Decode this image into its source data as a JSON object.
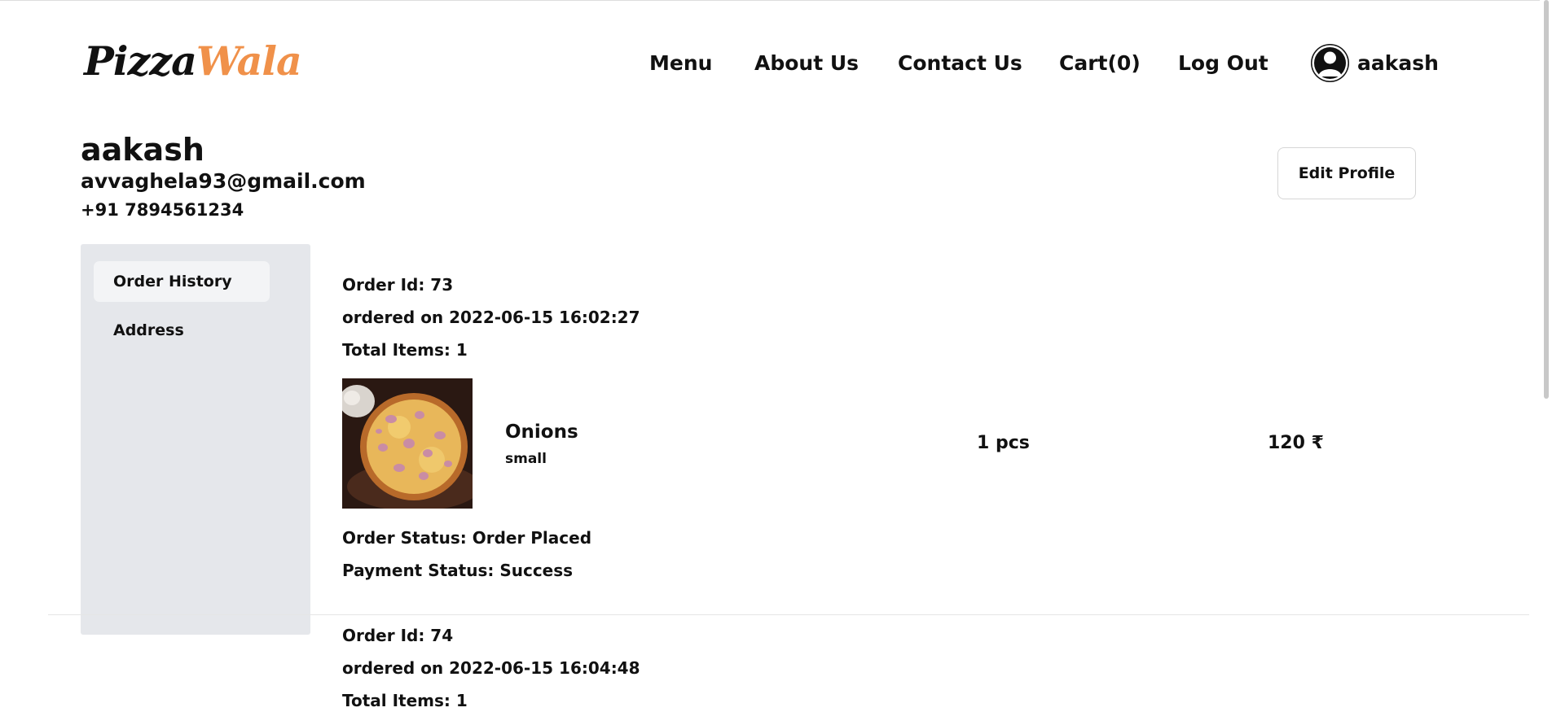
{
  "brand": {
    "part1": "Pizza",
    "part2": "Wala",
    "accent_color": "#f0914a"
  },
  "nav": {
    "items": [
      {
        "label": "Menu"
      },
      {
        "label": "About Us"
      },
      {
        "label": "Contact Us"
      },
      {
        "label": "Cart(0)"
      },
      {
        "label": "Log Out"
      }
    ],
    "user": {
      "icon": "user-avatar-icon",
      "name": "aakash"
    }
  },
  "profile": {
    "name": "aakash",
    "email": "avvaghela93@gmail.com",
    "phone": "+91 7894561234",
    "edit_label": "Edit Profile"
  },
  "sidebar": {
    "items": [
      {
        "label": "Order History",
        "active": true
      },
      {
        "label": "Address",
        "active": false
      }
    ]
  },
  "orders": [
    {
      "id_text": "Order Id: 73",
      "date_text": "ordered on 2022-06-15 16:02:27",
      "total_text": "Total Items: 1",
      "item": {
        "name": "Onions",
        "size": "small",
        "qty": "1 pcs",
        "price": "120 ₹"
      },
      "status_text": "Order Status: Order Placed",
      "payment_text": "Payment Status: Success"
    },
    {
      "id_text": "Order Id: 74",
      "date_text": "ordered on 2022-06-15 16:04:48",
      "total_text": "Total Items: 1"
    }
  ]
}
